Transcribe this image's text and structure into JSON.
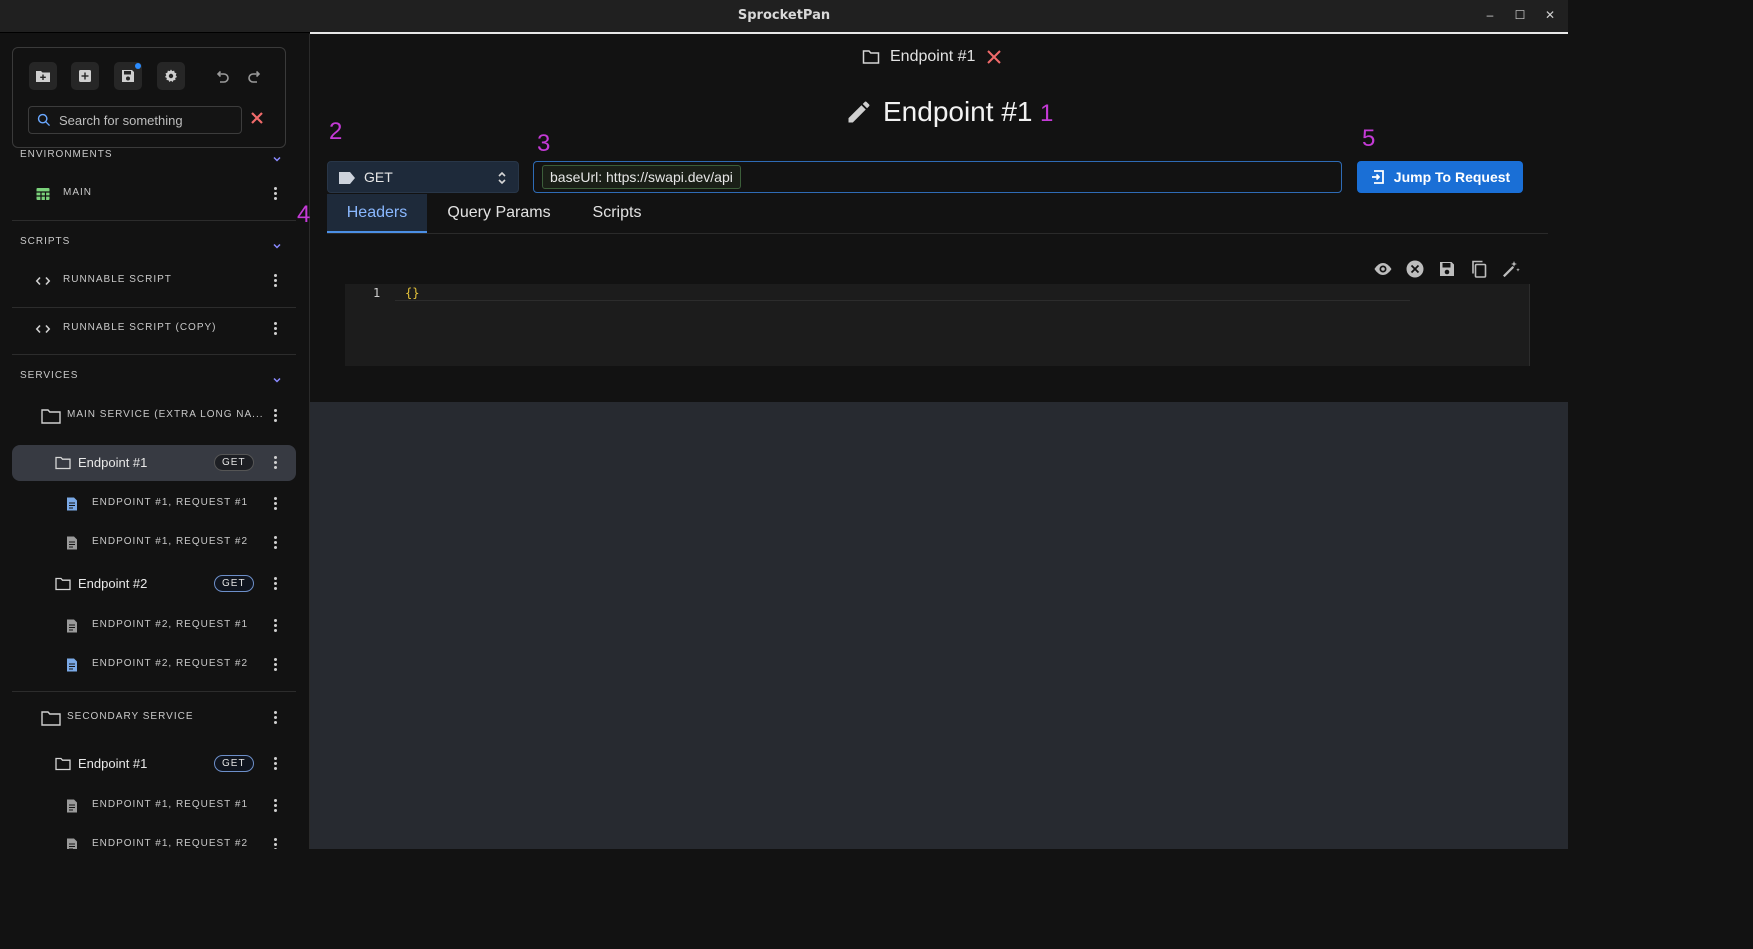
{
  "window": {
    "title": "SprocketPan",
    "controls": [
      "–",
      "☐",
      "✕"
    ]
  },
  "search": {
    "placeholder": "Search for something"
  },
  "sidebar": {
    "environments": {
      "header": "ENVIRONMENTS",
      "items": [
        {
          "label": "MAIN",
          "icon": "table-icon"
        }
      ]
    },
    "scripts": {
      "header": "SCRIPTS",
      "items": [
        {
          "label": "RUNNABLE SCRIPT",
          "icon": "code-icon"
        },
        {
          "label": "RUNNABLE SCRIPT (COPY)",
          "icon": "code-icon"
        }
      ]
    },
    "services": {
      "header": "SERVICES",
      "items": [
        {
          "label": "MAIN SERVICE (EXTRA LONG NA...",
          "type": "service"
        },
        {
          "label": "Endpoint #1",
          "badge": "GET",
          "type": "endpoint",
          "selected": true
        },
        {
          "label": "ENDPOINT #1, REQUEST #1",
          "type": "request"
        },
        {
          "label": "ENDPOINT #1, REQUEST #2",
          "type": "request"
        },
        {
          "label": "Endpoint #2",
          "badge": "GET",
          "type": "endpoint"
        },
        {
          "label": "ENDPOINT #2, REQUEST #1",
          "type": "request"
        },
        {
          "label": "ENDPOINT #2, REQUEST #2",
          "type": "request"
        },
        {
          "label": "SECONDARY SERVICE",
          "type": "service"
        },
        {
          "label": "Endpoint #1",
          "badge": "GET",
          "type": "endpoint"
        },
        {
          "label": "ENDPOINT #1, REQUEST #1",
          "type": "request"
        },
        {
          "label": "ENDPOINT #1, REQUEST #2",
          "type": "request"
        }
      ]
    }
  },
  "main": {
    "open_tab": "Endpoint #1",
    "heading": "Endpoint #1",
    "method": "GET",
    "url_chip": "baseUrl: https://swapi.dev/api",
    "jump_button": "Jump To Request",
    "tabs": [
      "Headers",
      "Query Params",
      "Scripts"
    ],
    "active_tab": "Headers",
    "editor": {
      "line_number": "1",
      "code": "{}"
    }
  },
  "annotations": [
    "1",
    "2",
    "3",
    "4",
    "5"
  ],
  "colors": {
    "accent": "#1a6fd6",
    "annotation": "#c43ad6",
    "close": "#f06a6a"
  }
}
